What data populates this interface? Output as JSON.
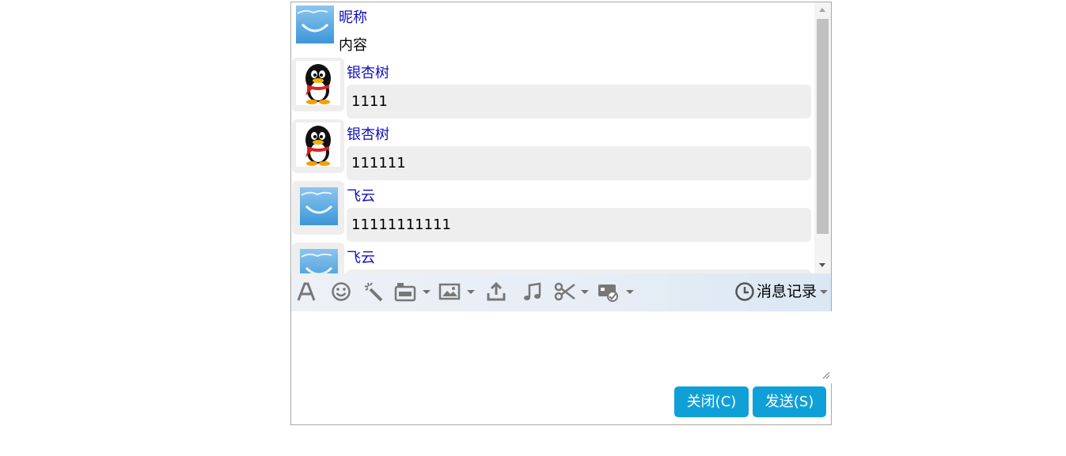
{
  "messages": [
    {
      "nickname": "昵称",
      "content": "内容",
      "avatar": "smile-avatar-icon"
    },
    {
      "nickname": "银杏树",
      "content": "1111",
      "avatar": "penguin-avatar-icon"
    },
    {
      "nickname": "银杏树",
      "content": "111111",
      "avatar": "penguin-avatar-icon"
    },
    {
      "nickname": "飞云",
      "content": "11111111111",
      "avatar": "smile-avatar-icon"
    },
    {
      "nickname": "飞云",
      "content": "",
      "avatar": "smile-avatar-icon"
    }
  ],
  "toolbar": {
    "icons": [
      "font-icon",
      "emoji-icon",
      "magic-wand-icon",
      "screen-capture-icon",
      "image-icon",
      "upload-icon",
      "music-icon",
      "scissors-icon",
      "remote-assist-icon"
    ],
    "history_label": "消息记录",
    "history_icon": "clock-icon"
  },
  "input": {
    "value": ""
  },
  "buttons": {
    "close_label": "关闭(C)",
    "send_label": "发送(S)"
  },
  "colors": {
    "accent": "#10a0d8",
    "nickname": "#1010c0",
    "bubble": "#eeeeee"
  }
}
